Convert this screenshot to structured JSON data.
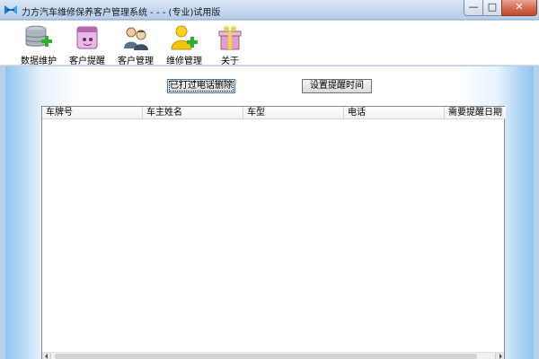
{
  "window": {
    "title": "力方汽车维修保养客户管理系统 - - - (专业)试用版",
    "controls": {
      "minimize": "—",
      "maximize": "□",
      "close": "✕"
    }
  },
  "toolbar": {
    "items": [
      {
        "label": "数据维护",
        "icon": "database-add-icon"
      },
      {
        "label": "客户提醒",
        "icon": "reminder-calendar-icon"
      },
      {
        "label": "客户管理",
        "icon": "users-icon"
      },
      {
        "label": "维修管理",
        "icon": "user-add-icon"
      },
      {
        "label": "关于",
        "icon": "gift-box-icon"
      }
    ]
  },
  "actions": {
    "delete_called_label": "已打过电话删除",
    "set_reminder_label": "设置提醒时间"
  },
  "list": {
    "columns": [
      "车牌号",
      "车主姓名",
      "车型",
      "电话",
      "需要提醒日期"
    ],
    "rows": []
  },
  "colors": {
    "accent": "#8fc3ef",
    "titlebar": "#c2d6ee",
    "close_button": "#d16a50"
  }
}
